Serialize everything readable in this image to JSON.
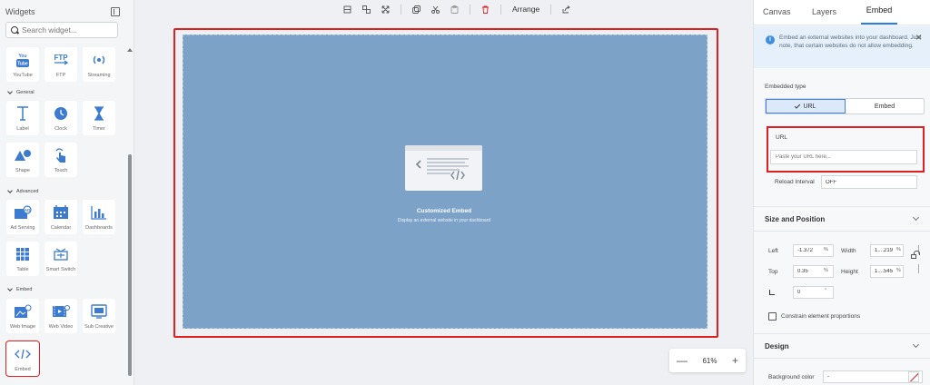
{
  "sidebar": {
    "title": "Widgets",
    "search_placeholder": "Search widget...",
    "top_tiles": [
      {
        "label": "YouTube",
        "icon": "youtube-icon",
        "glyph": "You\nTube"
      },
      {
        "label": "FTP",
        "icon": "ftp-icon",
        "glyph": "FTP"
      },
      {
        "label": "Streaming",
        "icon": "streaming-icon",
        "glyph": "((•))"
      }
    ],
    "sections": [
      {
        "name": "General",
        "tiles": [
          {
            "label": "Label",
            "icon": "text-icon"
          },
          {
            "label": "Clock",
            "icon": "clock-icon"
          },
          {
            "label": "Timer",
            "icon": "hourglass-icon"
          },
          {
            "label": "Shape",
            "icon": "shape-icon"
          },
          {
            "label": "Touch",
            "icon": "touch-icon"
          }
        ]
      },
      {
        "name": "Advanced",
        "tiles": [
          {
            "label": "Ad Serving",
            "icon": "ad-icon"
          },
          {
            "label": "Calendar",
            "icon": "calendar-icon"
          },
          {
            "label": "Dashboards",
            "icon": "dashboard-icon"
          },
          {
            "label": "Table",
            "icon": "table-icon"
          },
          {
            "label": "Smart Switch",
            "icon": "smart-switch-icon"
          }
        ]
      },
      {
        "name": "Embed",
        "tiles": [
          {
            "label": "Web Image",
            "icon": "web-image-icon"
          },
          {
            "label": "Web Video",
            "icon": "web-video-icon"
          },
          {
            "label": "Sub Creative",
            "icon": "sub-creative-icon"
          },
          {
            "label": "Embed",
            "icon": "embed-code-icon"
          }
        ]
      }
    ]
  },
  "toolbar": {
    "arrange_label": "Arrange"
  },
  "canvas": {
    "embed_title": "Customized Embed",
    "embed_subtitle": "Display an external website in your dashboard",
    "bg_color": "#7ca2c8"
  },
  "zoom": {
    "minus": "—",
    "value": "61%",
    "plus": "+"
  },
  "panel": {
    "tabs": [
      "Canvas",
      "Layers",
      "Embed"
    ],
    "active_tab": "Embed",
    "info_text": "Embed an external websites into your dashboard. Just note, that certain websites do not allow embedding.",
    "embedded_type_label": "Embedded type",
    "type_options": [
      "URL",
      "Embed"
    ],
    "url_label": "URL",
    "url_placeholder": "Paste your URL here...",
    "reload_label": "Reload Interval",
    "reload_value": "OFF",
    "size_section": "Size and Position",
    "left_label": "Left",
    "left_value": "-1.372",
    "top_label": "Top",
    "top_value": "0.35",
    "width_label": "Width",
    "width_value": "1....219",
    "height_label": "Height",
    "height_value": "1....545",
    "percent": "%",
    "rotation_value": "0",
    "degree": "°",
    "constrain_label": "Constrain element proportions",
    "design_section": "Design",
    "bg_color_label": "Background color",
    "bg_color_value": "-"
  },
  "colors": {
    "accent": "#2d7be5",
    "highlight_red": "#e02020",
    "icon_blue": "#3c7bd0"
  }
}
